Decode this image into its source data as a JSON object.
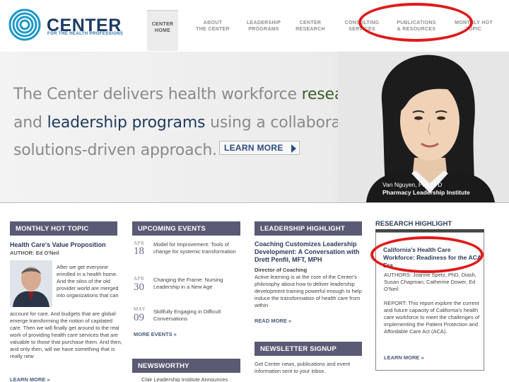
{
  "header": {
    "logo_word": "CENTER",
    "logo_sub": "FOR THE HEALTH PROFESSIONS",
    "nav": [
      {
        "label": "CENTER\nHOME",
        "active": true
      },
      {
        "label": "ABOUT\nTHE CENTER",
        "active": false
      },
      {
        "label": "LEADERSHIP\nPROGRAMS",
        "active": false
      },
      {
        "label": "CENTER\nRESEARCH",
        "active": false
      },
      {
        "label": "CONSULTING\nSERVICES",
        "active": false
      },
      {
        "label": "PUBLICATIONS\n& RESOURCES",
        "active": false
      },
      {
        "label": "MONTHLY HOT\nTOPIC",
        "active": false
      }
    ]
  },
  "hero": {
    "line1_a": "The Center delivers health workforce ",
    "line1_b": "research",
    "line2_a": "and ",
    "line2_b": "leadership programs",
    "line2_c": " using a collaborative,",
    "line3": "solutions-driven approach.",
    "learn_more": "LEARN MORE",
    "caption_name": "Van Nguyen, Pharm D",
    "caption_org": "Pharmacy Leadership Institute"
  },
  "monthly_hot_topic": {
    "heading": "MONTHLY HOT TOPIC",
    "title": "Health Care's Value Proposition",
    "author": "AUTHOR: Ed O'Neil",
    "body_right": "After we get everyone enrolled in a health home. And the silos of the old provider world are merged into organizations that can",
    "body_full": "account for care. And budgets that are global-emerge transforming the notion of capitated care. Then we will finally get around to the real work of providing health care services that are valuable to those that purchase them. And then, and only then, will we have something that is really new",
    "more": "LEARN MORE »"
  },
  "upcoming_events": {
    "heading": "UPCOMING EVENTS",
    "events": [
      {
        "month": "APR",
        "day": "18",
        "text": "Model for Improvement: Tools of change for systemic transformation"
      },
      {
        "month": "APR",
        "day": "30",
        "text": "Changing the Frame: Nursing Leadership in a New Age"
      },
      {
        "month": "MAY",
        "day": "09",
        "text": "Skillfully Engaging in Difficult Conversations"
      }
    ],
    "more": "MORE EVENTS »"
  },
  "newsworthy": {
    "heading": "NEWSWORTHY",
    "snippet": "Clair Leadership Institute Announces"
  },
  "leadership_highlight": {
    "heading": "LEADERSHIP HIGHLIGHT",
    "title": "Coaching Customizes Leadership Development: A Conversation with Drett Penfil, MFT, MPH",
    "role": "Director of Coaching",
    "body": "Active learning is at the core of the Center's philosophy about how to deliver leadership development training powerful enough to help induce the transformation of health care from within",
    "more": "READ MORE »"
  },
  "newsletter": {
    "heading": "NEWSLETTER SIGNUP",
    "body": "Get Center news, publications and event information sent to your inbox."
  },
  "research_highlight": {
    "heading": "RESEARCH HIGHLIGHT",
    "title": "California's Health Care Workforce: Readiness for the ACA Era",
    "authors": "AUTHORS: Joanne Spetz, PhD, Diash, Susan Chapman, Catherine Dower, Ed O'Neil",
    "report": "REPORT: This report explore the current and future capacity of California's health care workforce to meet the challenges of implementing the Patient Protection and Affordable Care Act (ACA).",
    "more": "LEARN MORE »"
  },
  "colors": {
    "header_navy": "#1d3a63",
    "section_header": "#5a5a74",
    "annotation_red": "#e01a1a"
  }
}
